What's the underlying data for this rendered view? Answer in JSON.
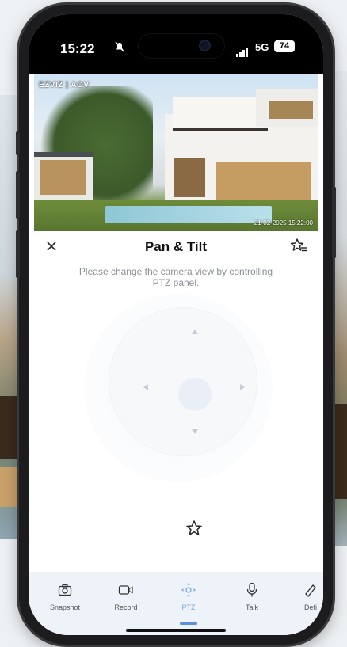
{
  "status_bar": {
    "time": "15:22",
    "network": "5G",
    "battery": "74"
  },
  "video": {
    "brand": "EZVIZ | AOV",
    "timestamp": "21-02-2025  15:22:00"
  },
  "panel": {
    "title": "Pan & Tilt",
    "description": "Please change the camera view by controlling PTZ panel."
  },
  "toolbar": {
    "items": [
      {
        "label": "Snapshot",
        "icon": "camera-icon"
      },
      {
        "label": "Record",
        "icon": "video-record-icon"
      },
      {
        "label": "PTZ",
        "icon": "ptz-icon",
        "active": true
      },
      {
        "label": "Talk",
        "icon": "microphone-icon"
      },
      {
        "label": "Defi",
        "icon": "definition-icon"
      }
    ]
  },
  "colors": {
    "accent": "#5b8fdc",
    "toolbar_bg": "#eef3fa",
    "pad_center": "#e9eef7"
  }
}
